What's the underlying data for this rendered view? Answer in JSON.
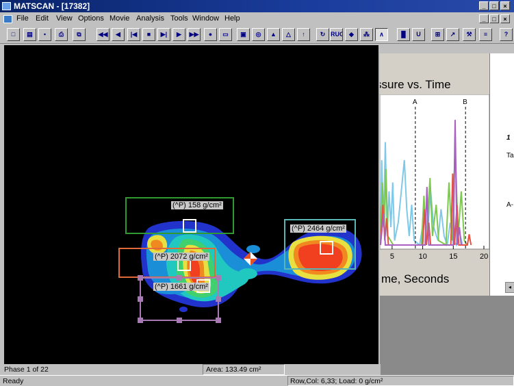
{
  "window": {
    "title": "MATSCAN - [17382]",
    "controls": [
      "_",
      "□",
      "×"
    ],
    "child_controls": [
      "_",
      "□",
      "×"
    ]
  },
  "menu": [
    {
      "label": "File"
    },
    {
      "label": "Edit"
    },
    {
      "label": "View"
    },
    {
      "label": "Options"
    },
    {
      "label": "Movie"
    },
    {
      "label": "Analysis"
    },
    {
      "label": "Tools"
    },
    {
      "label": "Window"
    },
    {
      "label": "Help"
    }
  ],
  "toolbar": [
    {
      "name": "new-icon",
      "glyph": "□"
    },
    {
      "name": "open-icon",
      "glyph": "▤"
    },
    {
      "name": "save-icon",
      "glyph": "▪"
    },
    {
      "name": "print-icon",
      "glyph": "⎙"
    },
    {
      "name": "copy-icon",
      "glyph": "⧉"
    },
    {
      "name": "rewind-icon",
      "glyph": "◀◀"
    },
    {
      "name": "step-back-icon",
      "glyph": "◀"
    },
    {
      "name": "go-start-icon",
      "glyph": "|◀"
    },
    {
      "name": "stop-icon",
      "glyph": "■"
    },
    {
      "name": "go-end-icon",
      "glyph": "▶|"
    },
    {
      "name": "play-icon",
      "glyph": "▶"
    },
    {
      "name": "fast-forward-icon",
      "glyph": "▶▶"
    },
    {
      "name": "record-icon",
      "glyph": "●"
    },
    {
      "name": "frame-icon",
      "glyph": "▭"
    },
    {
      "name": "display-2d-icon",
      "glyph": "▣"
    },
    {
      "name": "contour-icon",
      "glyph": "◎"
    },
    {
      "name": "display-3d-icon",
      "glyph": "▲"
    },
    {
      "name": "wireframe-icon",
      "glyph": "△"
    },
    {
      "name": "graph-icon",
      "glyph": "↑"
    },
    {
      "name": "refresh-icon",
      "glyph": "↻"
    },
    {
      "name": "rug-icon",
      "glyph": "RUG"
    },
    {
      "name": "center-force-icon",
      "glyph": "◆"
    },
    {
      "name": "cof-trajectory-icon",
      "glyph": "⁂"
    },
    {
      "name": "peak-icon",
      "glyph": "∧"
    },
    {
      "name": "color-scale-icon",
      "glyph": "█"
    },
    {
      "name": "calibrate-icon",
      "glyph": "U"
    },
    {
      "name": "grid-icon",
      "glyph": "⊞"
    },
    {
      "name": "chart-icon",
      "glyph": "↗"
    },
    {
      "name": "tools-icon",
      "glyph": "⚒"
    },
    {
      "name": "report-icon",
      "glyph": "≡"
    },
    {
      "name": "help-icon",
      "glyph": "?"
    }
  ],
  "boxes": [
    {
      "name": "box-toes",
      "label": "(^P) 158 g/cm²",
      "color": "#2f9a2f"
    },
    {
      "name": "box-forefoot",
      "label": "(^P) 2464 g/cm²",
      "color": "#59b6b6"
    },
    {
      "name": "box-midfoot",
      "label": "(^P) 2072 g/cm²",
      "color": "#e26a3a"
    },
    {
      "name": "box-heel",
      "label": "(^P) 1661 g/cm²",
      "color": "#a77ab4"
    }
  ],
  "chart_data": {
    "type": "line",
    "title": "ssure vs. Time",
    "xlabel": "me, Seconds",
    "x_ticks": [
      "5",
      "10",
      "15",
      "20"
    ],
    "xlim": [
      3,
      20
    ],
    "markers": [
      {
        "label": "A",
        "x": 8.8
      },
      {
        "label": "B",
        "x": 17
      }
    ],
    "series": [
      {
        "color": "#7ec8e8",
        "values": [
          [
            3.1,
            0
          ],
          [
            3.3,
            95
          ],
          [
            3.6,
            20
          ],
          [
            3.9,
            115
          ],
          [
            4.2,
            10
          ],
          [
            4.5,
            60
          ],
          [
            4.8,
            20
          ],
          [
            5.1,
            70
          ],
          [
            5.4,
            5
          ],
          [
            6,
            25
          ],
          [
            6.5,
            60
          ],
          [
            7.0,
            95
          ],
          [
            7.4,
            40
          ],
          [
            7.8,
            10
          ],
          [
            8.2,
            45
          ],
          [
            8.6,
            5
          ],
          [
            9.5,
            0
          ],
          [
            10.2,
            30
          ],
          [
            10.8,
            15
          ],
          [
            11.3,
            60
          ],
          [
            11.8,
            20
          ],
          [
            12.5,
            5
          ],
          [
            13.0,
            40
          ],
          [
            13.5,
            10
          ],
          [
            14.0,
            0
          ],
          [
            14.5,
            25
          ],
          [
            15.0,
            5
          ],
          [
            15.5,
            0
          ],
          [
            16.0,
            15
          ],
          [
            16.5,
            0
          ]
        ]
      },
      {
        "color": "#7ec850",
        "values": [
          [
            3.1,
            0
          ],
          [
            3.4,
            70
          ],
          [
            3.7,
            20
          ],
          [
            4.0,
            85
          ],
          [
            4.3,
            10
          ],
          [
            5.2,
            0
          ],
          [
            9.8,
            0
          ],
          [
            10.2,
            55
          ],
          [
            10.6,
            5
          ],
          [
            11.2,
            75
          ],
          [
            11.6,
            10
          ],
          [
            12.2,
            45
          ],
          [
            12.6,
            5
          ],
          [
            13.8,
            0
          ],
          [
            14.3,
            70
          ],
          [
            14.8,
            5
          ],
          [
            15.3,
            110
          ],
          [
            15.8,
            10
          ],
          [
            16.3,
            60
          ],
          [
            16.8,
            5
          ],
          [
            17.3,
            0
          ]
        ]
      },
      {
        "color": "#e85040",
        "values": [
          [
            3.1,
            0
          ],
          [
            3.5,
            45
          ],
          [
            3.8,
            5
          ],
          [
            4.1,
            30
          ],
          [
            4.4,
            0
          ],
          [
            10.0,
            0
          ],
          [
            10.3,
            40
          ],
          [
            10.6,
            0
          ],
          [
            11.0,
            25
          ],
          [
            11.3,
            0
          ],
          [
            14.6,
            0
          ],
          [
            14.9,
            80
          ],
          [
            15.2,
            0
          ],
          [
            15.6,
            45
          ],
          [
            15.9,
            0
          ],
          [
            17.3,
            0
          ],
          [
            17.6,
            12
          ],
          [
            17.9,
            0
          ]
        ]
      },
      {
        "color": "#a860c0",
        "values": [
          [
            3.1,
            0
          ],
          [
            3.6,
            35
          ],
          [
            3.9,
            0
          ],
          [
            10.4,
            0
          ],
          [
            10.7,
            65
          ],
          [
            11.0,
            0
          ],
          [
            15.0,
            0
          ],
          [
            15.3,
            140
          ],
          [
            15.6,
            0
          ],
          [
            16.0,
            20
          ],
          [
            16.3,
            0
          ]
        ]
      }
    ]
  },
  "right_panel": {
    "side_labels": [
      "1",
      "Ta",
      "A-"
    ]
  },
  "status": {
    "phase": "Phase 1 of 22",
    "area": "Area: 133.49 cm²",
    "ready": "Ready",
    "rowcol": "Row,Col: 6,33;  Load: 0 g/cm²"
  }
}
